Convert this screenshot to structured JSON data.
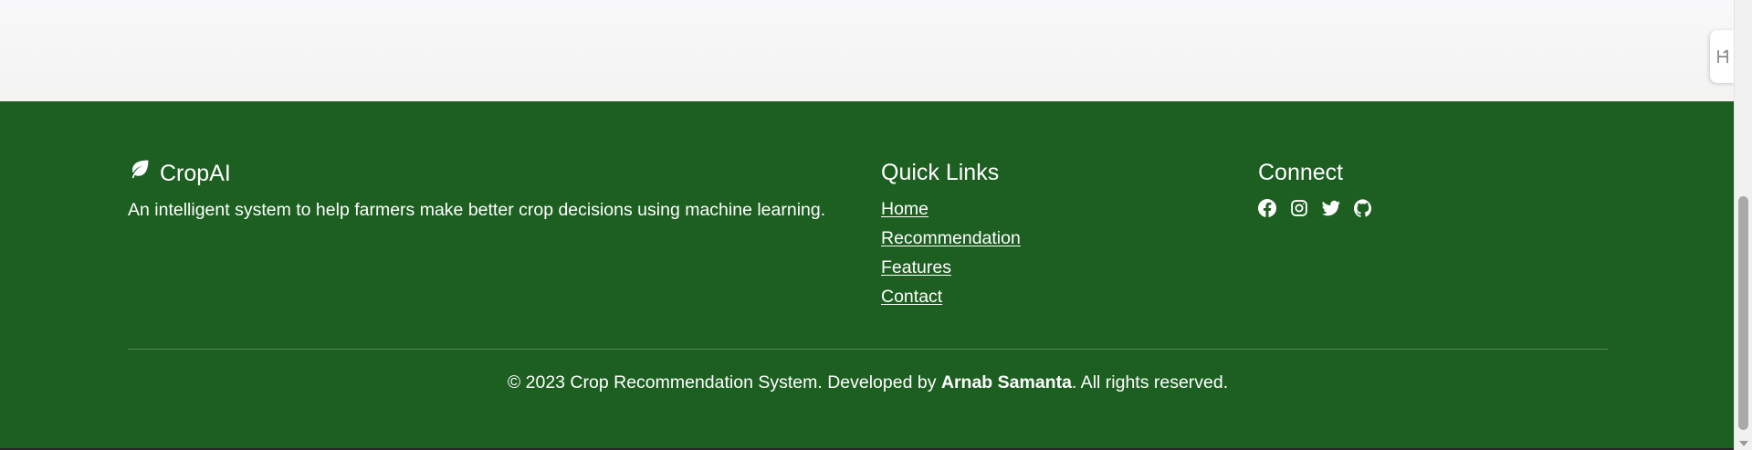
{
  "brand": {
    "name": "CropAI",
    "icon": "leaf-icon",
    "description": "An intelligent system to help farmers make better crop decisions using machine learning."
  },
  "quick_links": {
    "heading": "Quick Links",
    "items": [
      {
        "label": "Home"
      },
      {
        "label": "Recommendation"
      },
      {
        "label": "Features"
      },
      {
        "label": "Contact"
      }
    ]
  },
  "connect": {
    "heading": "Connect",
    "icons": [
      "facebook-icon",
      "instagram-icon",
      "twitter-icon",
      "github-icon"
    ]
  },
  "copyright": {
    "prefix": "© 2023 Crop Recommendation System. Developed by ",
    "author": "Arnab Samanta",
    "suffix": ". All rights reserved."
  },
  "colors": {
    "footer_bg": "#1d5e21",
    "text": "#ffffff",
    "page_bg": "#f6f5f5"
  }
}
